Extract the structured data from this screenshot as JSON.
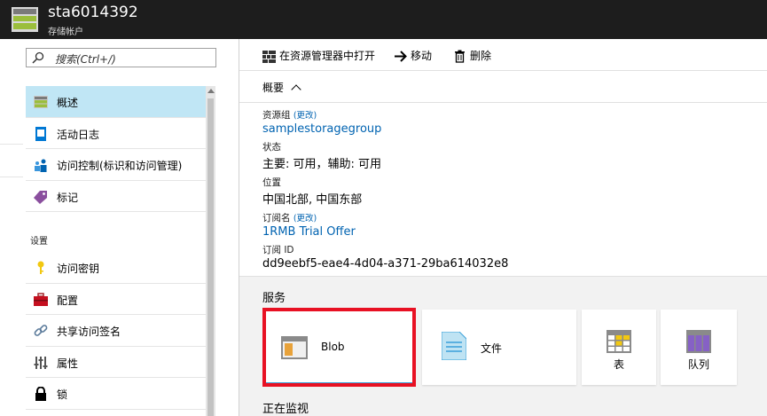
{
  "header": {
    "title": "sta6014392",
    "subtitle": "存储帐户",
    "accent_color": "#9bbe3c"
  },
  "search": {
    "placeholder": "搜索(Ctrl+/)"
  },
  "menu": {
    "items": [
      {
        "label": "概述",
        "icon": "storage-account-icon",
        "active": true
      },
      {
        "label": "活动日志",
        "icon": "activity-log-icon"
      },
      {
        "label": "访问控制(标识和访问管理)",
        "icon": "people-icon"
      },
      {
        "label": "标记",
        "icon": "tag-icon"
      }
    ],
    "section_label": "设置",
    "settings_items": [
      {
        "label": "访问密钥",
        "icon": "key-icon"
      },
      {
        "label": "配置",
        "icon": "toolbox-icon"
      },
      {
        "label": "共享访问签名",
        "icon": "link-icon"
      },
      {
        "label": "属性",
        "icon": "properties-icon"
      },
      {
        "label": "锁",
        "icon": "lock-icon"
      }
    ]
  },
  "toolbar": {
    "open_explorer": "在资源管理器中打开",
    "move": "移动",
    "delete": "删除"
  },
  "essentials": {
    "label": "概要"
  },
  "properties": {
    "resource_group_label": "资源组",
    "change_label": "(更改)",
    "resource_group_value": "samplestoragegroup",
    "status_label": "状态",
    "status_value": "主要: 可用，辅助: 可用",
    "location_label": "位置",
    "location_value": "中国北部, 中国东部",
    "subscription_label": "订阅名",
    "subscription_value": "1RMB Trial Offer",
    "subscription_id_label": "订阅 ID",
    "subscription_id_value": "dd9eebf5-eae4-4d04-a371-29ba614032e8"
  },
  "services": {
    "title": "服务",
    "tiles": [
      {
        "label": "Blob",
        "icon": "blob-icon"
      },
      {
        "label": "文件",
        "icon": "file-icon"
      },
      {
        "label": "表",
        "icon": "table-icon"
      },
      {
        "label": "队列",
        "icon": "queue-icon"
      }
    ],
    "highlight_color": "#e81123"
  },
  "monitoring": {
    "title": "正在监视"
  }
}
